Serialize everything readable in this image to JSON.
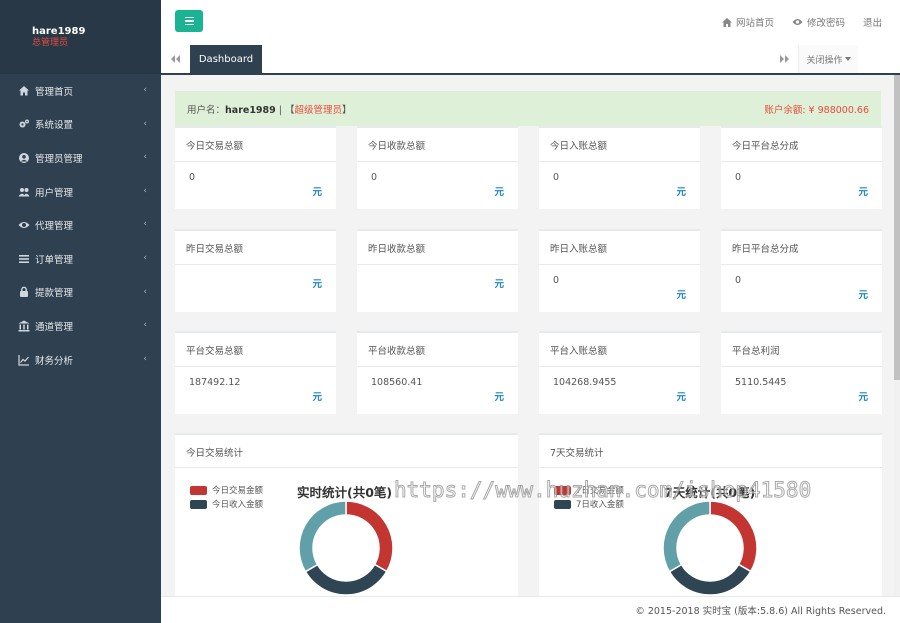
{
  "profile": {
    "username": "hare1989",
    "role": "总管理员"
  },
  "sidebar": {
    "items": [
      {
        "label": "管理首页",
        "icon": "home-icon"
      },
      {
        "label": "系统设置",
        "icon": "cogs-icon"
      },
      {
        "label": "管理员管理",
        "icon": "user-circle-icon"
      },
      {
        "label": "用户管理",
        "icon": "users-icon"
      },
      {
        "label": "代理管理",
        "icon": "eye-icon"
      },
      {
        "label": "订单管理",
        "icon": "list-icon"
      },
      {
        "label": "提款管理",
        "icon": "lock-icon"
      },
      {
        "label": "通道管理",
        "icon": "bank-icon"
      },
      {
        "label": "财务分析",
        "icon": "line-chart-icon"
      }
    ]
  },
  "header": {
    "home": "网站首页",
    "password": "修改密码",
    "logout": "退出"
  },
  "tabs": {
    "active": "Dashboard",
    "close_ops": "关闭操作"
  },
  "userbar": {
    "prefix": "用户名：",
    "username": "hare1989",
    "bracket_open": "【",
    "role": "超级管理员",
    "bracket_close": "】",
    "balance": "账户余额: ¥ 988000.66"
  },
  "cards": [
    {
      "title": "今日交易总额",
      "value": "0",
      "unit": "元"
    },
    {
      "title": "今日收款总额",
      "value": "0",
      "unit": "元"
    },
    {
      "title": "今日入账总额",
      "value": "0",
      "unit": "元"
    },
    {
      "title": "今日平台总分成",
      "value": "0",
      "unit": "元"
    },
    {
      "title": "昨日交易总额",
      "value": "",
      "unit": "元"
    },
    {
      "title": "昨日收款总额",
      "value": "",
      "unit": "元"
    },
    {
      "title": "昨日入账总额",
      "value": "0",
      "unit": "元"
    },
    {
      "title": "昨日平台总分成",
      "value": "0",
      "unit": "元"
    },
    {
      "title": "平台交易总额",
      "value": "187492.12",
      "unit": "元"
    },
    {
      "title": "平台收款总额",
      "value": "108560.41",
      "unit": "元"
    },
    {
      "title": "平台入账总额",
      "value": "104268.9455",
      "unit": "元"
    },
    {
      "title": "平台总利润",
      "value": "5110.5445",
      "unit": "元"
    }
  ],
  "panels": [
    {
      "header": "今日交易统计",
      "title": "实时统计(共0笔)",
      "legend": [
        "今日交易金额",
        "今日收入金额"
      ]
    },
    {
      "header": "7天交易统计",
      "title": "7天统计(共0笔)",
      "legend": [
        "7日交易金额",
        "7日收入金额"
      ]
    }
  ],
  "chart_data": [
    {
      "type": "pie",
      "title": "实时统计(共0笔)",
      "legend": "top-left",
      "slices": [
        {
          "name": "",
          "value": 33.3,
          "color": "#c23531"
        },
        {
          "name": "",
          "value": 33.3,
          "color": "#2f4554"
        },
        {
          "name": "",
          "value": 33.4,
          "color": "#61a0a8"
        }
      ]
    },
    {
      "type": "pie",
      "title": "7天统计(共0笔)",
      "legend": "top-left",
      "slices": [
        {
          "name": "",
          "value": 33.3,
          "color": "#c23531"
        },
        {
          "name": "",
          "value": 33.3,
          "color": "#2f4554"
        },
        {
          "name": "",
          "value": 33.4,
          "color": "#61a0a8"
        }
      ]
    }
  ],
  "colors": {
    "legend_series_1": "#c23531",
    "legend_series_2": "#2f4554",
    "accent": "#1ab394",
    "sidebar": "#2f4050",
    "unit": "#1c84c6",
    "alert": "#e74c3c"
  },
  "footer": "© 2015-2018 实时宝 (版本:5.8.6) All Rights Reserved.",
  "watermark": "https://www.huzhan.com/ishop41580"
}
